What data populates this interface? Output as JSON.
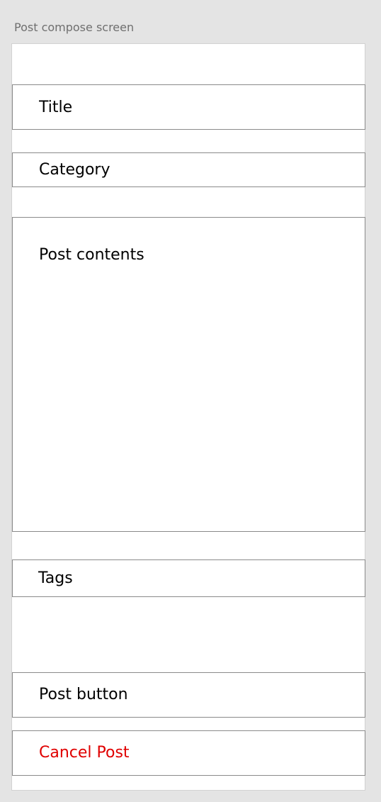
{
  "screen": {
    "label": "Post compose screen"
  },
  "form": {
    "title_placeholder": "Title",
    "category_placeholder": "Category",
    "contents_placeholder": "Post contents",
    "tags_placeholder": "Tags"
  },
  "actions": {
    "post_label": "Post button",
    "cancel_label": "Cancel Post"
  },
  "colors": {
    "background": "#e4e4e4",
    "card": "#ffffff",
    "border": "#8a8a8a",
    "cancel_text": "#e00000"
  }
}
